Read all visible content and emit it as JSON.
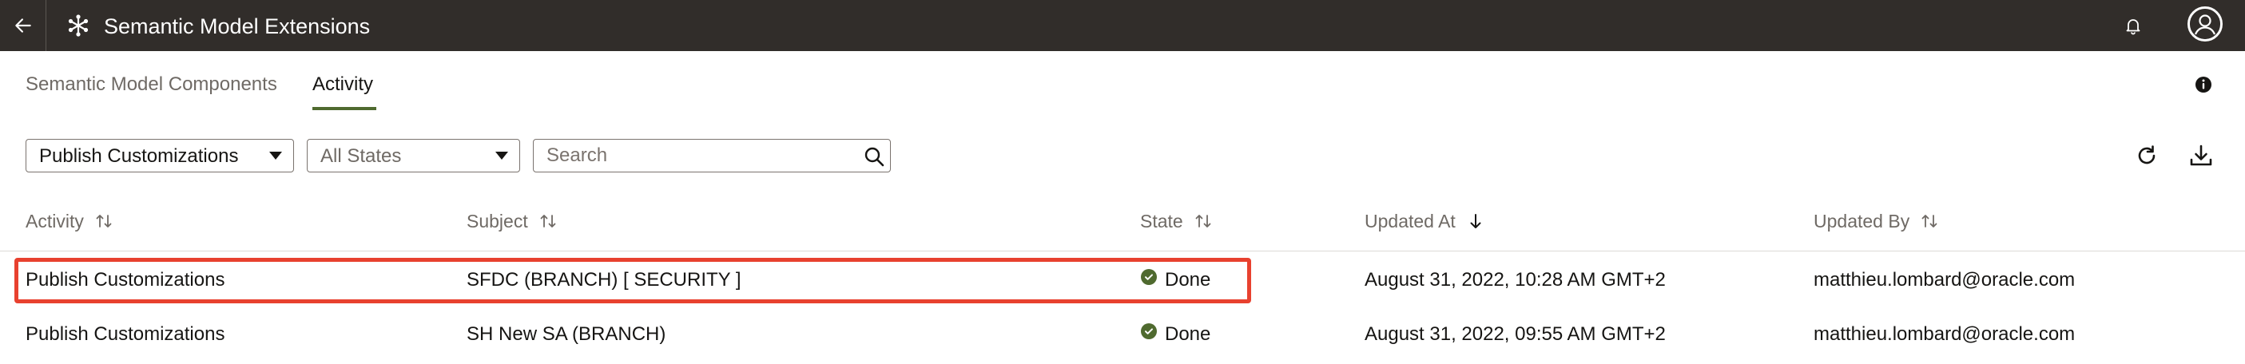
{
  "header": {
    "title": "Semantic Model Extensions",
    "back_icon": "arrow-left-icon",
    "app_icon": "snowflake-icon",
    "bell_icon": "bell-icon",
    "avatar_icon": "user-avatar-icon",
    "background_color": "#312d2a"
  },
  "tabs": [
    {
      "label": "Semantic Model Components",
      "active": false
    },
    {
      "label": "Activity",
      "active": true
    }
  ],
  "accent_color": "#4f6a2f",
  "info_icon": "info-icon",
  "filters": {
    "activity_select": {
      "value": "Publish Customizations"
    },
    "state_select": {
      "value": "All States"
    },
    "search": {
      "placeholder": "Search",
      "value": ""
    }
  },
  "toolbar": {
    "refresh_icon": "refresh-icon",
    "download_icon": "download-icon"
  },
  "table": {
    "columns": [
      {
        "label": "Activity",
        "sort": "none"
      },
      {
        "label": "Subject",
        "sort": "none"
      },
      {
        "label": "State",
        "sort": "none"
      },
      {
        "label": "Updated At",
        "sort": "descending"
      },
      {
        "label": "Updated By",
        "sort": "none"
      }
    ],
    "rows": [
      {
        "activity": "Publish Customizations",
        "subject": "SFDC (BRANCH) [ SECURITY ]",
        "state": "Done",
        "updated_at": "August 31, 2022, 10:28 AM GMT+2",
        "updated_by": "matthieu.lombard@oracle.com",
        "highlighted": true
      },
      {
        "activity": "Publish Customizations",
        "subject": "SH New SA (BRANCH)",
        "state": "Done",
        "updated_at": "August 31, 2022, 09:55 AM GMT+2",
        "updated_by": "matthieu.lombard@oracle.com",
        "highlighted": false
      }
    ],
    "state_done_color": "#4f6a2f",
    "highlight_color": "#e8412f"
  }
}
